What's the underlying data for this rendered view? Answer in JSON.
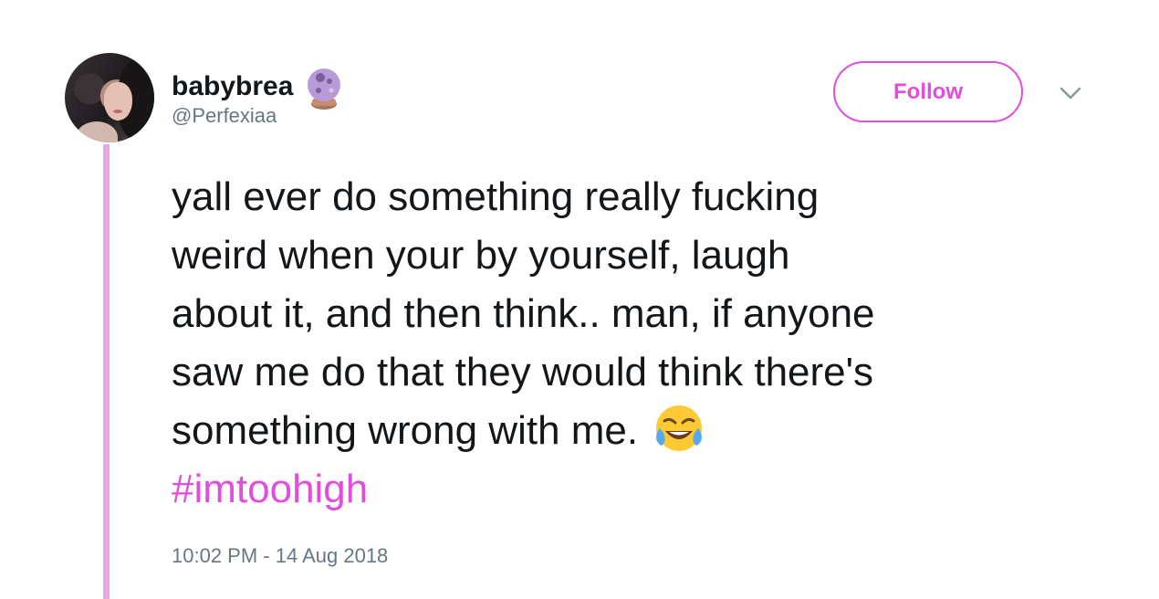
{
  "tweet": {
    "display_name": "babybrea",
    "handle": "@Perfexiaa",
    "name_emoji": "crystal-ball-icon",
    "follow_label": "Follow",
    "menu_icon": "chevron-down-icon",
    "text_lines": [
      "yall ever do something really fucking",
      "weird when your by yourself, laugh",
      "about it, and then think.. man, if anyone",
      "saw me do that they would think there's",
      "something wrong with me."
    ],
    "end_emoji": "face-with-tears-of-joy-icon",
    "hashtag": "#imtoohigh",
    "timestamp": "10:02 PM - 14 Aug 2018"
  },
  "colors": {
    "accent": "#E24DDD",
    "thread_line": "#E8A7EA",
    "secondary_text": "#657786",
    "primary_text": "#14171A"
  }
}
